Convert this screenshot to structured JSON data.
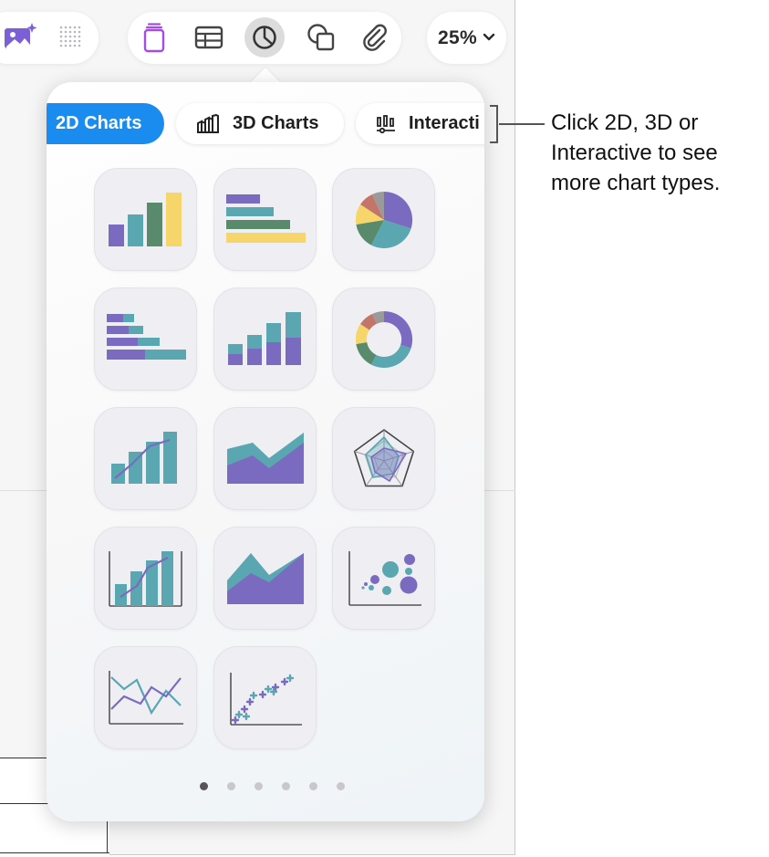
{
  "toolbar": {
    "left_icons": [
      "media-sparkle-icon",
      "grid-icon"
    ],
    "items": [
      {
        "name": "text-box-icon",
        "color": "#a24ee0"
      },
      {
        "name": "table-icon",
        "color": "#444444"
      },
      {
        "name": "chart-icon",
        "color": "#444444",
        "selected": true
      },
      {
        "name": "shapes-icon",
        "color": "#444444"
      },
      {
        "name": "paperclip-icon",
        "color": "#444444"
      }
    ],
    "zoom": "25%"
  },
  "popover": {
    "tabs": [
      {
        "label": "2D Charts",
        "selected": true
      },
      {
        "label": "3D Charts",
        "icon": "3d-bars-icon"
      },
      {
        "label": "Interacti",
        "icon": "interactive-chart-icon"
      }
    ],
    "chart_types": [
      "column-chart",
      "bar-chart",
      "pie-chart",
      "stacked-bar-chart",
      "stacked-column-chart",
      "donut-chart",
      "column-line-chart",
      "stacked-area-chart",
      "radar-chart",
      "two-axis-column-line-chart",
      "area-chart",
      "bubble-chart",
      "line-chart",
      "scatter-chart"
    ],
    "page_dots": {
      "count": 6,
      "active": 1
    }
  },
  "callout": {
    "text": "Click 2D, 3D or Interactive to see more chart types."
  },
  "colors": {
    "accent": "#1a8cf0",
    "purple": "#7b6bc0",
    "teal": "#5aa6b1",
    "green": "#5a8a6c",
    "yellow": "#f6d66a",
    "red": "#c4756a",
    "gray": "#9a9a9a"
  }
}
